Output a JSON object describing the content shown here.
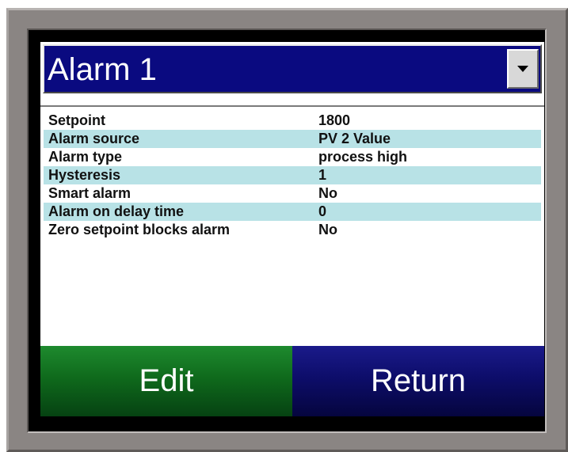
{
  "header": {
    "title": "Alarm 1",
    "dropdown_icon": "chevron-down-icon"
  },
  "parameters": [
    {
      "label": "Setpoint",
      "value": "1800"
    },
    {
      "label": "Alarm source",
      "value": "PV 2 Value"
    },
    {
      "label": "Alarm type",
      "value": "process high"
    },
    {
      "label": "Hysteresis",
      "value": "1"
    },
    {
      "label": "Smart alarm",
      "value": "No"
    },
    {
      "label": "Alarm on delay time",
      "value": "0"
    },
    {
      "label": "Zero setpoint blocks alarm",
      "value": "No"
    }
  ],
  "buttons": {
    "edit_label": "Edit",
    "return_label": "Return"
  },
  "colors": {
    "title_bar": "#0a0a80",
    "row_highlight": "#b8e2e6",
    "edit_button": "#0f6a1c",
    "return_button": "#0d0d6a",
    "bezel": "#8a8583"
  }
}
